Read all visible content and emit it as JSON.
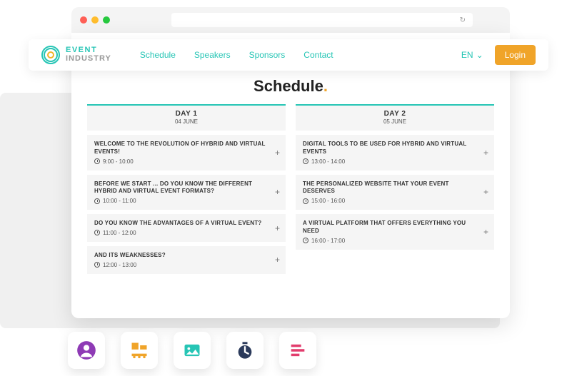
{
  "browser": {
    "refresh_glyph": "↻"
  },
  "logo": {
    "top": "EVENT",
    "bottom": "INDUSTRY"
  },
  "nav": {
    "schedule": "Schedule",
    "speakers": "Speakers",
    "sponsors": "Sponsors",
    "contact": "Contact"
  },
  "lang": {
    "label": "EN",
    "chevron": "⌄"
  },
  "login": "Login",
  "page_title": "Schedule",
  "page_title_dot": ".",
  "day_label_prefix": "DAY ",
  "days": [
    {
      "num": "1",
      "date": "04 JUNE",
      "sessions": [
        {
          "title": "WELCOME TO THE REVOLUTION OF HYBRID AND VIRTUAL EVENTS!",
          "time": "9:00 - 10:00"
        },
        {
          "title": "BEFORE WE START ... DO YOU KNOW THE DIFFERENT HYBRID AND VIRTUAL EVENT FORMATS?",
          "time": "10:00 - 11:00"
        },
        {
          "title": "DO YOU KNOW THE ADVANTAGES OF A VIRTUAL EVENT?",
          "time": "11:00 - 12:00"
        },
        {
          "title": "AND ITS WEAKNESSES?",
          "time": "12:00 - 13:00"
        }
      ]
    },
    {
      "num": "2",
      "date": "05 JUNE",
      "sessions": [
        {
          "title": "DIGITAL TOOLS TO BE USED FOR HYBRID AND VIRTUAL EVENTS",
          "time": "13:00 - 14:00"
        },
        {
          "title": "THE PERSONALIZED WEBSITE THAT YOUR EVENT DESERVES",
          "time": "15:00 - 16:00"
        },
        {
          "title": "A VIRTUAL PLATFORM THAT OFFERS EVERYTHING YOU NEED",
          "time": "16:00 - 17:00"
        }
      ]
    }
  ],
  "expand_glyph": "+",
  "toolbar": {
    "user": "user-icon",
    "blocks": "blocks-icon",
    "image": "image-icon",
    "timer": "timer-icon",
    "text": "text-icon"
  }
}
